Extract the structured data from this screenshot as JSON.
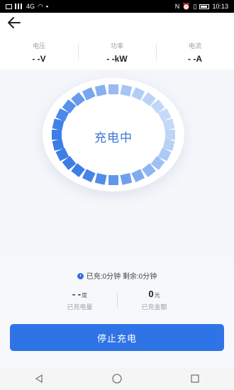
{
  "status_bar": {
    "time": "10:13",
    "network": "4G"
  },
  "metrics": [
    {
      "label": "电压",
      "value": "- -V"
    },
    {
      "label": "功率",
      "value": "- -kW"
    },
    {
      "label": "电流",
      "value": "- -A"
    }
  ],
  "charging": {
    "status_text": "充电中",
    "progress_segments_total": 28,
    "ring_colors": {
      "active": "#3d7ee6",
      "inactive": "#dbe8fb"
    }
  },
  "time": {
    "charged_label": "已充",
    "charged_value": "0分钟",
    "remaining_label": "剩余",
    "remaining_value": "0分钟"
  },
  "stats": {
    "energy_value": "- -",
    "energy_unit": "度",
    "energy_label": "已充电量",
    "amount_value": "0",
    "amount_unit": "元",
    "amount_label": "已充金额"
  },
  "actions": {
    "stop_label": "停止充电"
  },
  "colors": {
    "accent": "#2f74e6"
  }
}
